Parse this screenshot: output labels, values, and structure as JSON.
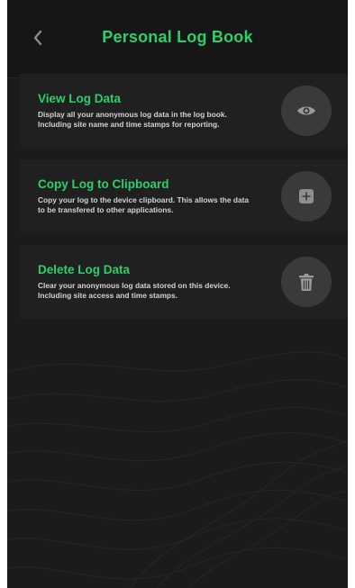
{
  "header": {
    "title": "Personal Log Book",
    "back_icon": "chevron-left-icon"
  },
  "items": [
    {
      "title": "View Log Data",
      "description": "Display all your anonymous log data in the log book. Including site name and time stamps for reporting.",
      "icon": "eye-icon"
    },
    {
      "title": "Copy Log to Clipboard",
      "description": "Copy your log to the device clipboard.  This allows the data to be transfered to other applications.",
      "icon": "plus-square-icon"
    },
    {
      "title": "Delete Log Data",
      "description": "Clear your anonymous log data stored on this device. Including site access and time stamps.",
      "icon": "trash-icon"
    }
  ],
  "colors": {
    "accent": "#2bd06a",
    "background": "#1b1b1b",
    "card": "#202020",
    "button": "#3a3a3a"
  }
}
